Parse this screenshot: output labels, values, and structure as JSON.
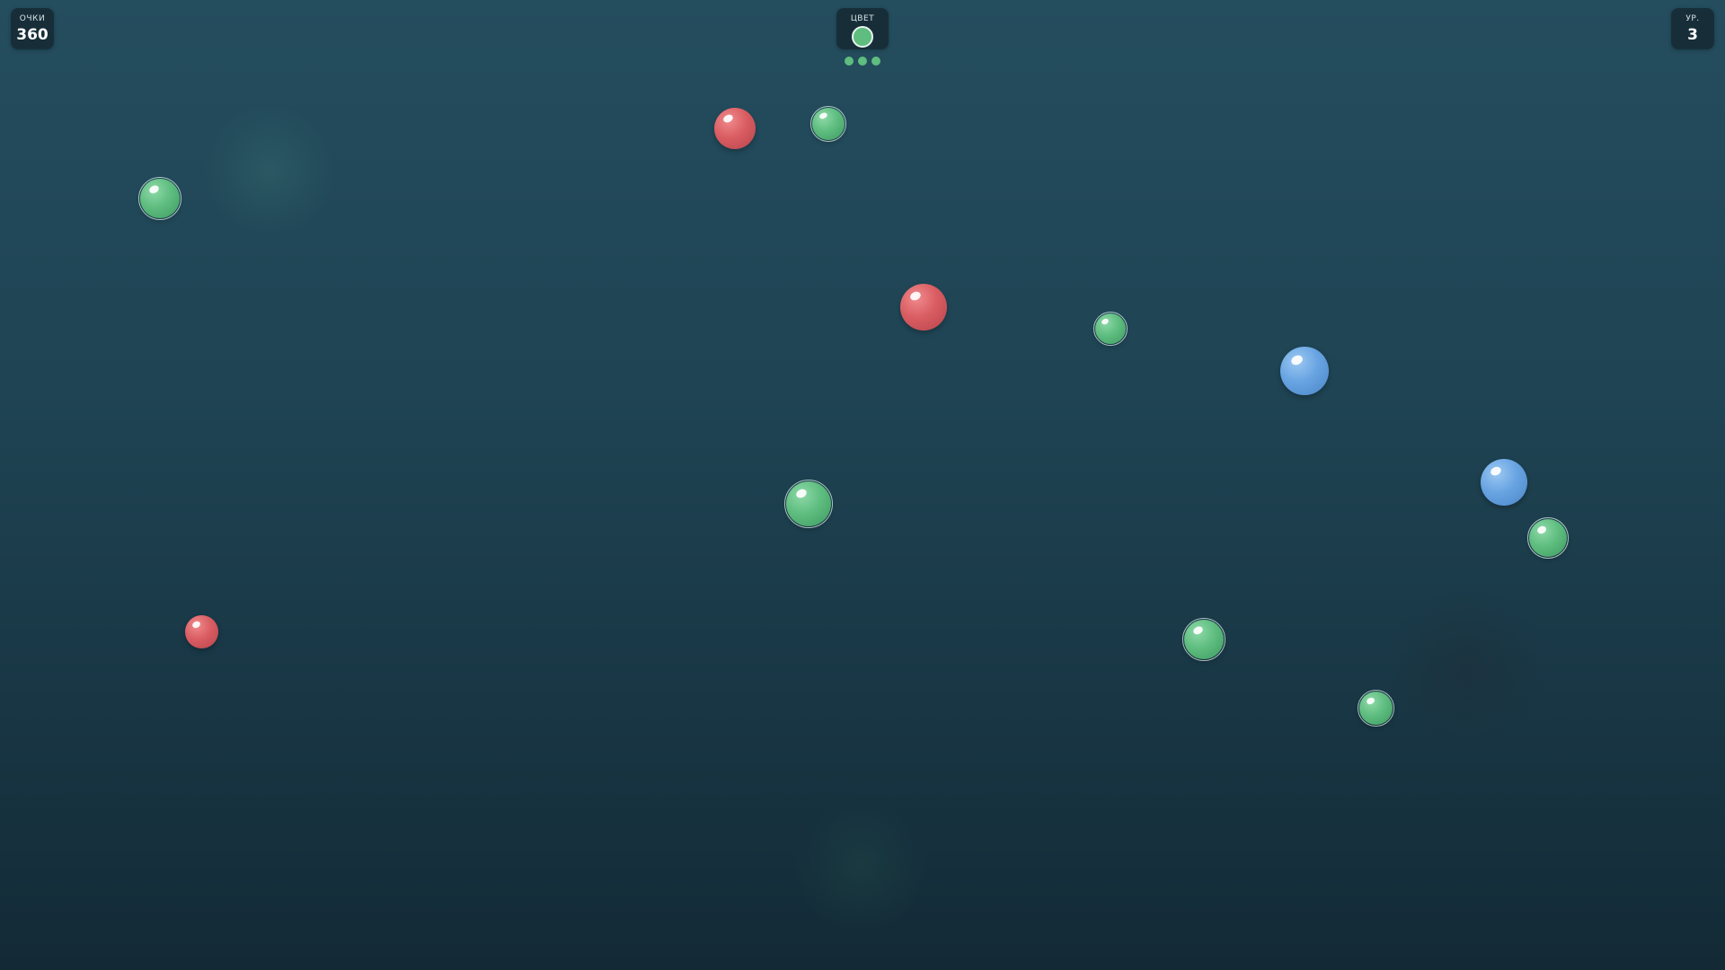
{
  "hud": {
    "score": {
      "label": "ОЧКИ",
      "value": "360"
    },
    "target_color": {
      "label": "ЦВЕТ",
      "color": "green",
      "hex": "#5ebd7f"
    },
    "level": {
      "label": "УР.",
      "value": "3"
    },
    "lives": {
      "count": 3,
      "hex": "#5ebd7f"
    }
  },
  "colors": {
    "green": "#5ebd7f",
    "red": "#d95d62",
    "blue": "#68a4e2",
    "background_top": "#244d5e",
    "background_bottom": "#132a36"
  },
  "balls": [
    {
      "color": "green",
      "is_target": true
    },
    {
      "color": "red",
      "is_target": false
    },
    {
      "color": "green",
      "is_target": true
    },
    {
      "color": "red",
      "is_target": false
    },
    {
      "color": "green",
      "is_target": true
    },
    {
      "color": "blue",
      "is_target": false
    },
    {
      "color": "blue",
      "is_target": false
    },
    {
      "color": "green",
      "is_target": true
    },
    {
      "color": "green",
      "is_target": true
    },
    {
      "color": "red",
      "is_target": false
    },
    {
      "color": "green",
      "is_target": true
    },
    {
      "color": "green",
      "is_target": true
    }
  ]
}
